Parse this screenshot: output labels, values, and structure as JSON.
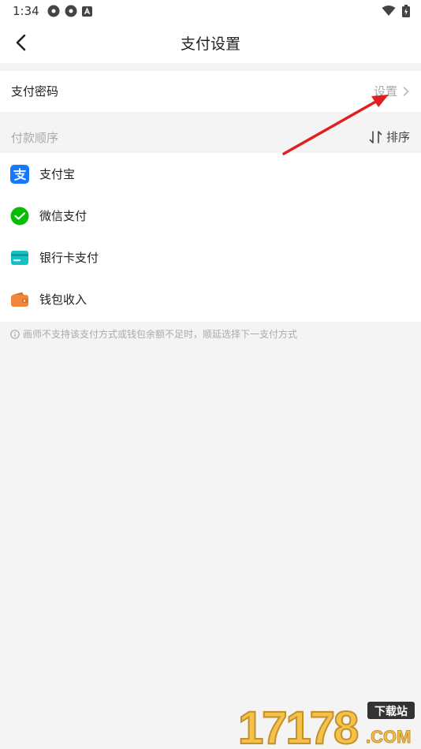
{
  "status_bar": {
    "time": "1:34"
  },
  "header": {
    "title": "支付设置"
  },
  "password_row": {
    "label": "支付密码",
    "action": "设置"
  },
  "section": {
    "label": "付款顺序",
    "sort_label": "排序"
  },
  "methods": [
    {
      "label": "支付宝",
      "icon": "alipay-icon",
      "color": "#1677ff"
    },
    {
      "label": "微信支付",
      "icon": "wechat-pay-icon",
      "color": "#09bb07"
    },
    {
      "label": "银行卡支付",
      "icon": "bank-card-icon",
      "color": "#13c2c2"
    },
    {
      "label": "钱包收入",
      "icon": "wallet-icon",
      "color": "#f0873a"
    }
  ],
  "tip": "画师不支持该支付方式或钱包余额不足时，顺延选择下一支付方式",
  "watermark": {
    "number": "17178",
    "sub": "下载站",
    "domain": ".COM"
  },
  "colors": {
    "annotation_arrow": "#e02020",
    "background": "#f4f4f4"
  }
}
